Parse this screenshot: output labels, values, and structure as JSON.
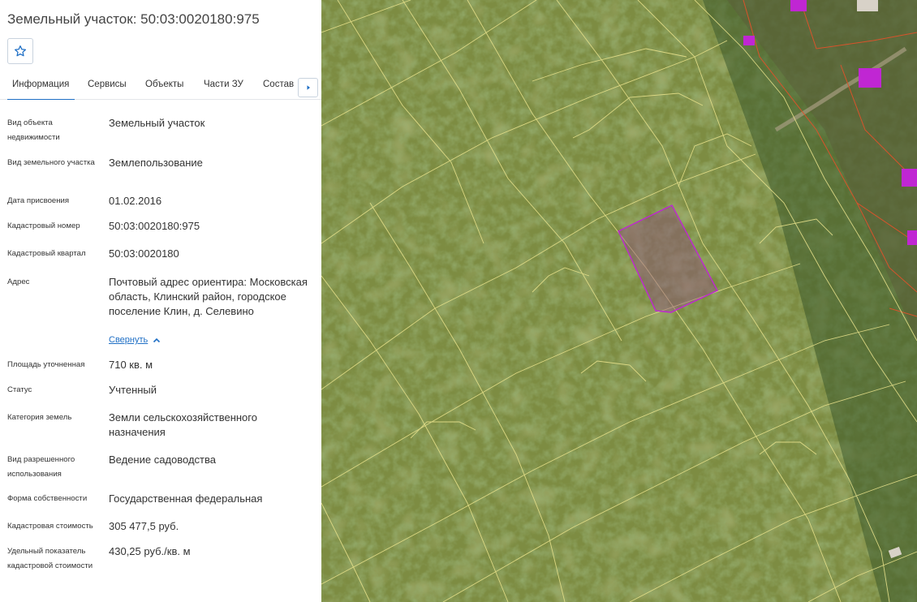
{
  "panel": {
    "title": "Земельный участок: 50:03:0020180:975",
    "favorite_icon": "star-outline-icon",
    "tabs": [
      {
        "label": "Информация",
        "active": true
      },
      {
        "label": "Сервисы"
      },
      {
        "label": "Объекты"
      },
      {
        "label": "Части ЗУ"
      },
      {
        "label": "Состав ЕЗП"
      }
    ],
    "tabs_next_icon": "caret-right-icon",
    "accent_color": "#1f6fc5",
    "rows": [
      {
        "label": "Вид объекта недвижимости",
        "value": "Земельный участок"
      },
      {
        "label": "Вид земельного участка",
        "value": "Землепользование"
      },
      {
        "label": "Дата присвоения",
        "value": "01.02.2016"
      },
      {
        "label": "Кадастровый номер",
        "value": "50:03:0020180:975"
      },
      {
        "label": "Кадастровый квартал",
        "value": "50:03:0020180"
      },
      {
        "label": "Адрес",
        "value": "Почтовый адрес ориентира: Московская область, Клинский район, городское поселение Клин, д. Селевино"
      },
      {
        "label": "Площадь уточненная",
        "value": "710 кв. м"
      },
      {
        "label": "Статус",
        "value": "Учтенный"
      },
      {
        "label": "Категория земель",
        "value": "Земли сельскохозяйственного назначения"
      },
      {
        "label": "Вид разрешенного использования",
        "value": "Ведение садоводства"
      },
      {
        "label": "Форма собственности",
        "value": "Государственная федеральная"
      },
      {
        "label": "Кадастровая стоимость",
        "value": "305 477,5 руб."
      },
      {
        "label": "Удельный показатель кадастровой стоимости",
        "value": "430,25 руб./кв. м"
      }
    ],
    "collapse_link": "Свернуть",
    "collapse_icon": "chevron-up-icon"
  },
  "map": {
    "parcel_line_color": "#e6e08a",
    "selected_parcel_color": "#c026d3",
    "building_color": "#c026d3",
    "boundary_line_color": "#d9532b"
  }
}
